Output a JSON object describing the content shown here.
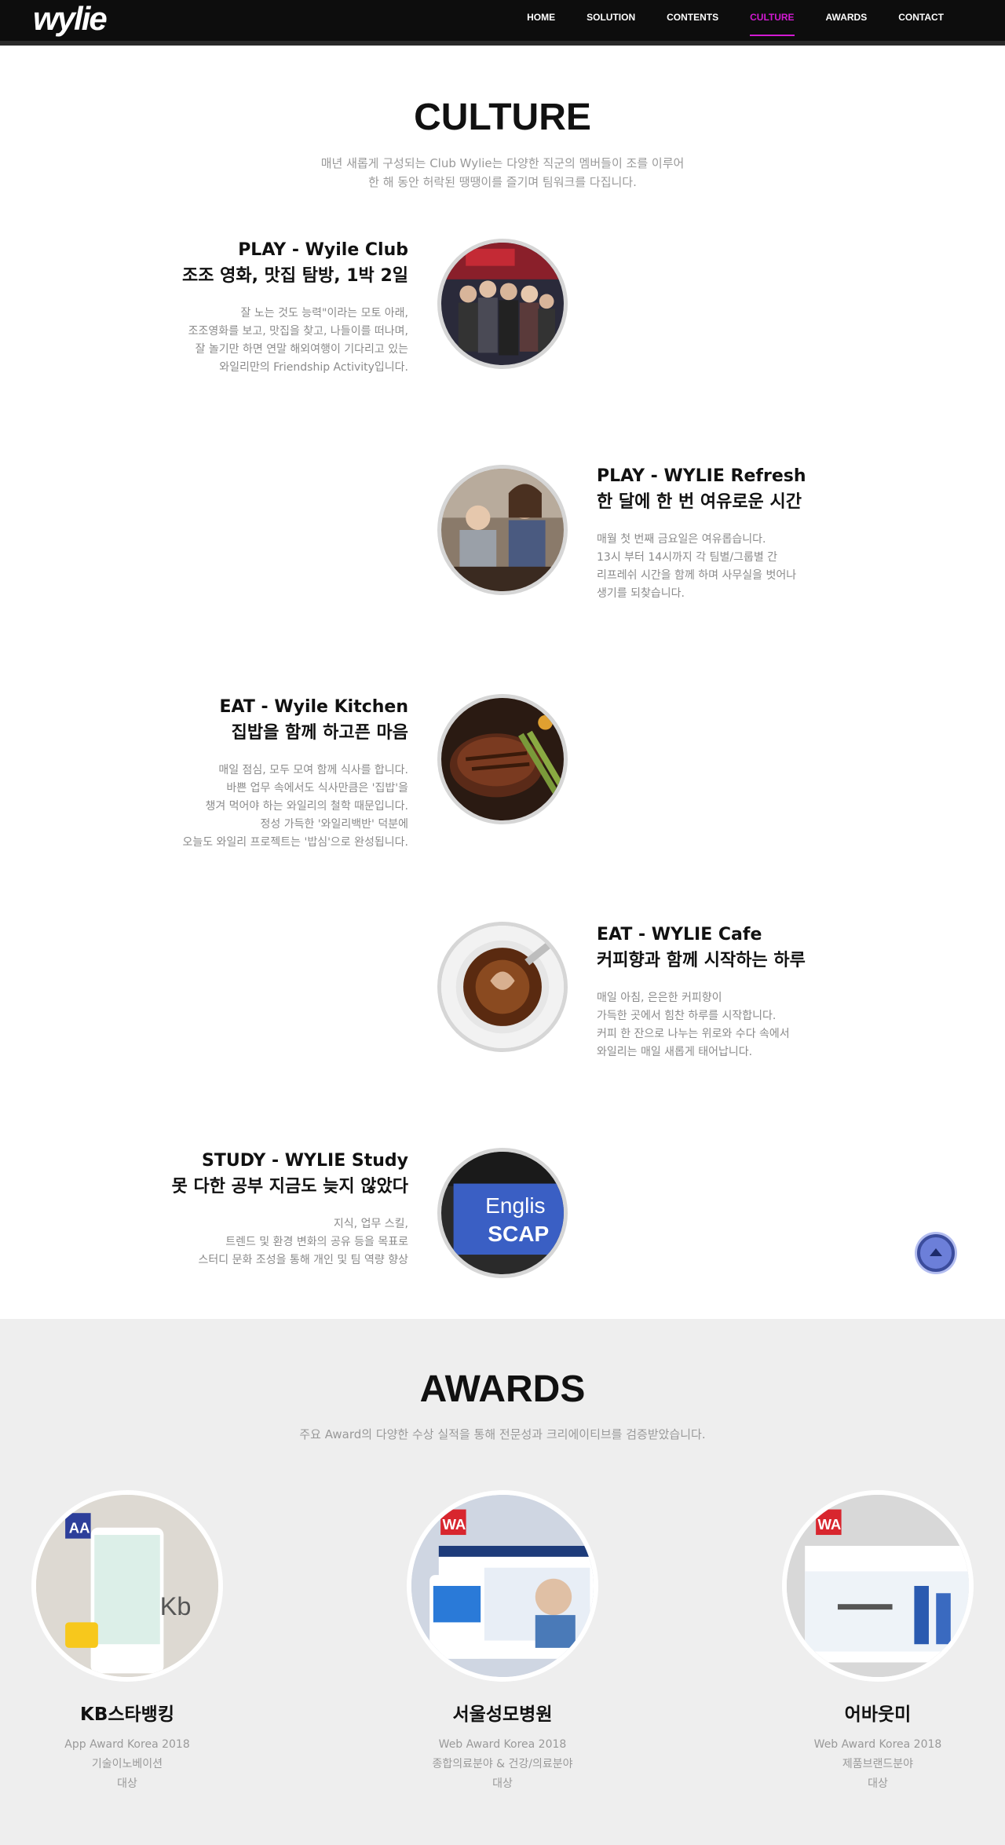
{
  "header": {
    "logo": "wylie",
    "nav": [
      "HOME",
      "SOLUTION",
      "CONTENTS",
      "CULTURE",
      "AWARDS",
      "CONTACT"
    ],
    "active": "CULTURE",
    "accent": "#d21ad2"
  },
  "culture": {
    "title": "CULTURE",
    "desc_line1": "매년 새롭게 구성되는 Club Wylie는 다양한 직군의 멤버들이 조를 이루어",
    "desc_line2": "한 해 동안 허락된 땡땡이를 즐기며 팀워크를 다집니다.",
    "items": [
      {
        "title1": "PLAY - Wyile Club",
        "title2": "조조 영화, 맛집 탐방, 1박 2일",
        "lines": [
          "잘 노는 것도 능력\"이라는 모토 아래,",
          "조조영화를 보고, 맛집을 찾고, 나들이를 떠나며,",
          "잘 놀기만 하면 연말 해외여행이 기다리고 있는",
          "와일리만의 Friendship Activity입니다."
        ]
      },
      {
        "title1": "PLAY - WYLIE Refresh",
        "title2": "한 달에 한 번 여유로운 시간",
        "lines": [
          "매월 첫 번째 금요일은 여유롭습니다.",
          "13시 부터 14시까지 각 팀별/그룹별 간",
          "리프레쉬 시간을 함께 하며 사무실을 벗어나",
          "생기를 되찾습니다."
        ]
      },
      {
        "title1": "EAT - Wyile Kitchen",
        "title2": "집밥을 함께 하고픈 마음",
        "lines": [
          "매일 점심, 모두 모여 함께 식사를 합니다.",
          "바쁜 업무 속에서도 식사만큼은 '집밥'을",
          "챙겨 먹어야 하는 와일리의 철학 때문입니다.",
          "정성 가득한 '와일리백반' 덕분에",
          "오늘도 와일리 프로젝트는 '밥심'으로 완성됩니다."
        ]
      },
      {
        "title1": "EAT - WYLIE Cafe",
        "title2": "커피향과 함께 시작하는 하루",
        "lines": [
          "매일 아침, 은은한 커피향이",
          "가득한 곳에서 힘찬 하루를 시작합니다.",
          "커피 한 잔으로 나누는 위로와 수다 속에서",
          "와일리는 매일 새롭게 태어납니다."
        ]
      },
      {
        "title1": "STUDY - WYLIE Study",
        "title2": "못 다한 공부 지금도 늦지 않았다",
        "lines": [
          "지식, 업무 스킬,",
          "트렌드 및 환경 변화의 공유 등을 목표로",
          "스터디 문화 조성을 통해 개인 및 팀 역량 향상"
        ]
      }
    ],
    "photo_text": {
      "study_line1": "Englis",
      "study_line2": "SCAP"
    }
  },
  "awards": {
    "title": "AWARDS",
    "desc": "주요 Award의 다양한 수상 실적을 통해 전문성과 크리에이티브를 검증받았습니다.",
    "items": [
      {
        "name": "KB스타뱅킹",
        "line1": "App Award Korea 2018",
        "line2": "기술이노베이션",
        "line3": "대상",
        "badge": "AA",
        "badge_color": "#2d3f9a"
      },
      {
        "name": "서울성모병원",
        "line1": "Web Award Korea 2018",
        "line2": "종합의료분야 & 건강/의료분야",
        "line3": "대상",
        "badge": "WA",
        "badge_color": "#d8262e"
      },
      {
        "name": "어바웃미",
        "line1": "Web Award Korea 2018",
        "line2": "제품브랜드분야",
        "line3": "대상",
        "badge": "WA",
        "badge_color": "#d8262e"
      }
    ]
  }
}
